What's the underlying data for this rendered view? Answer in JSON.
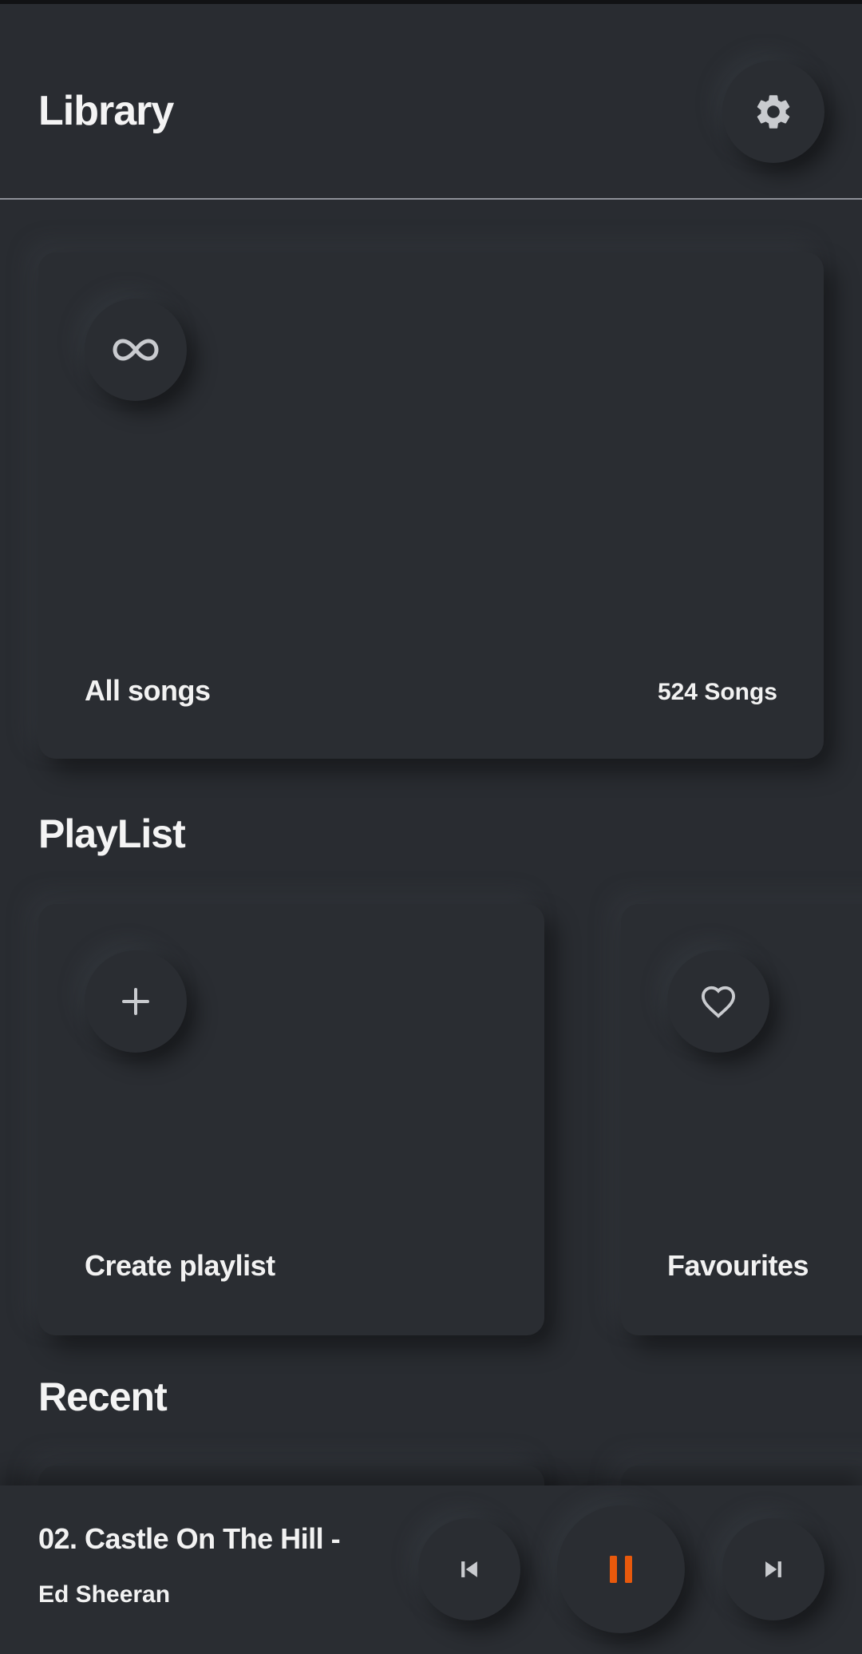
{
  "header": {
    "title": "Library"
  },
  "all_songs": {
    "label": "All songs",
    "count": "524 Songs"
  },
  "sections": {
    "playlist": "PlayList",
    "recent": "Recent"
  },
  "playlists": [
    {
      "label": "Create playlist",
      "icon": "plus-icon"
    },
    {
      "label": "Favourites",
      "icon": "heart-icon"
    }
  ],
  "player": {
    "track_title": "02. Castle On The Hill - …",
    "artist": "Ed Sheeran",
    "state": "playing"
  },
  "colors": {
    "background": "#292c31",
    "accent": "#e8590c",
    "icon": "#c9cbcf"
  }
}
